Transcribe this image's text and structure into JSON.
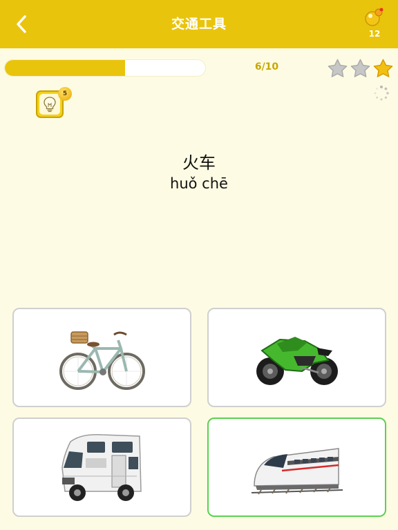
{
  "header": {
    "title": "交通工具",
    "coins": "12",
    "bg_color": "#e9c40c"
  },
  "progress": {
    "current": 6,
    "total": 10,
    "text": "6/10",
    "fraction": 0.6
  },
  "stars": {
    "earned": 1,
    "total": 3
  },
  "hint": {
    "count": "5",
    "icon": "lightbulb-icon"
  },
  "word": {
    "hanzi": "火车",
    "pinyin": "huǒ chē"
  },
  "options": [
    {
      "name": "bicycle",
      "icon": "bicycle-image",
      "selected": false
    },
    {
      "name": "motorcycle",
      "icon": "motorcycle-image",
      "selected": false
    },
    {
      "name": "camper-van",
      "icon": "camper-van-image",
      "selected": false
    },
    {
      "name": "train",
      "icon": "train-image",
      "selected": true
    }
  ],
  "colors": {
    "accent": "#e9c40c",
    "selected_border": "#5bd052",
    "card_border": "#cfcfcf"
  }
}
